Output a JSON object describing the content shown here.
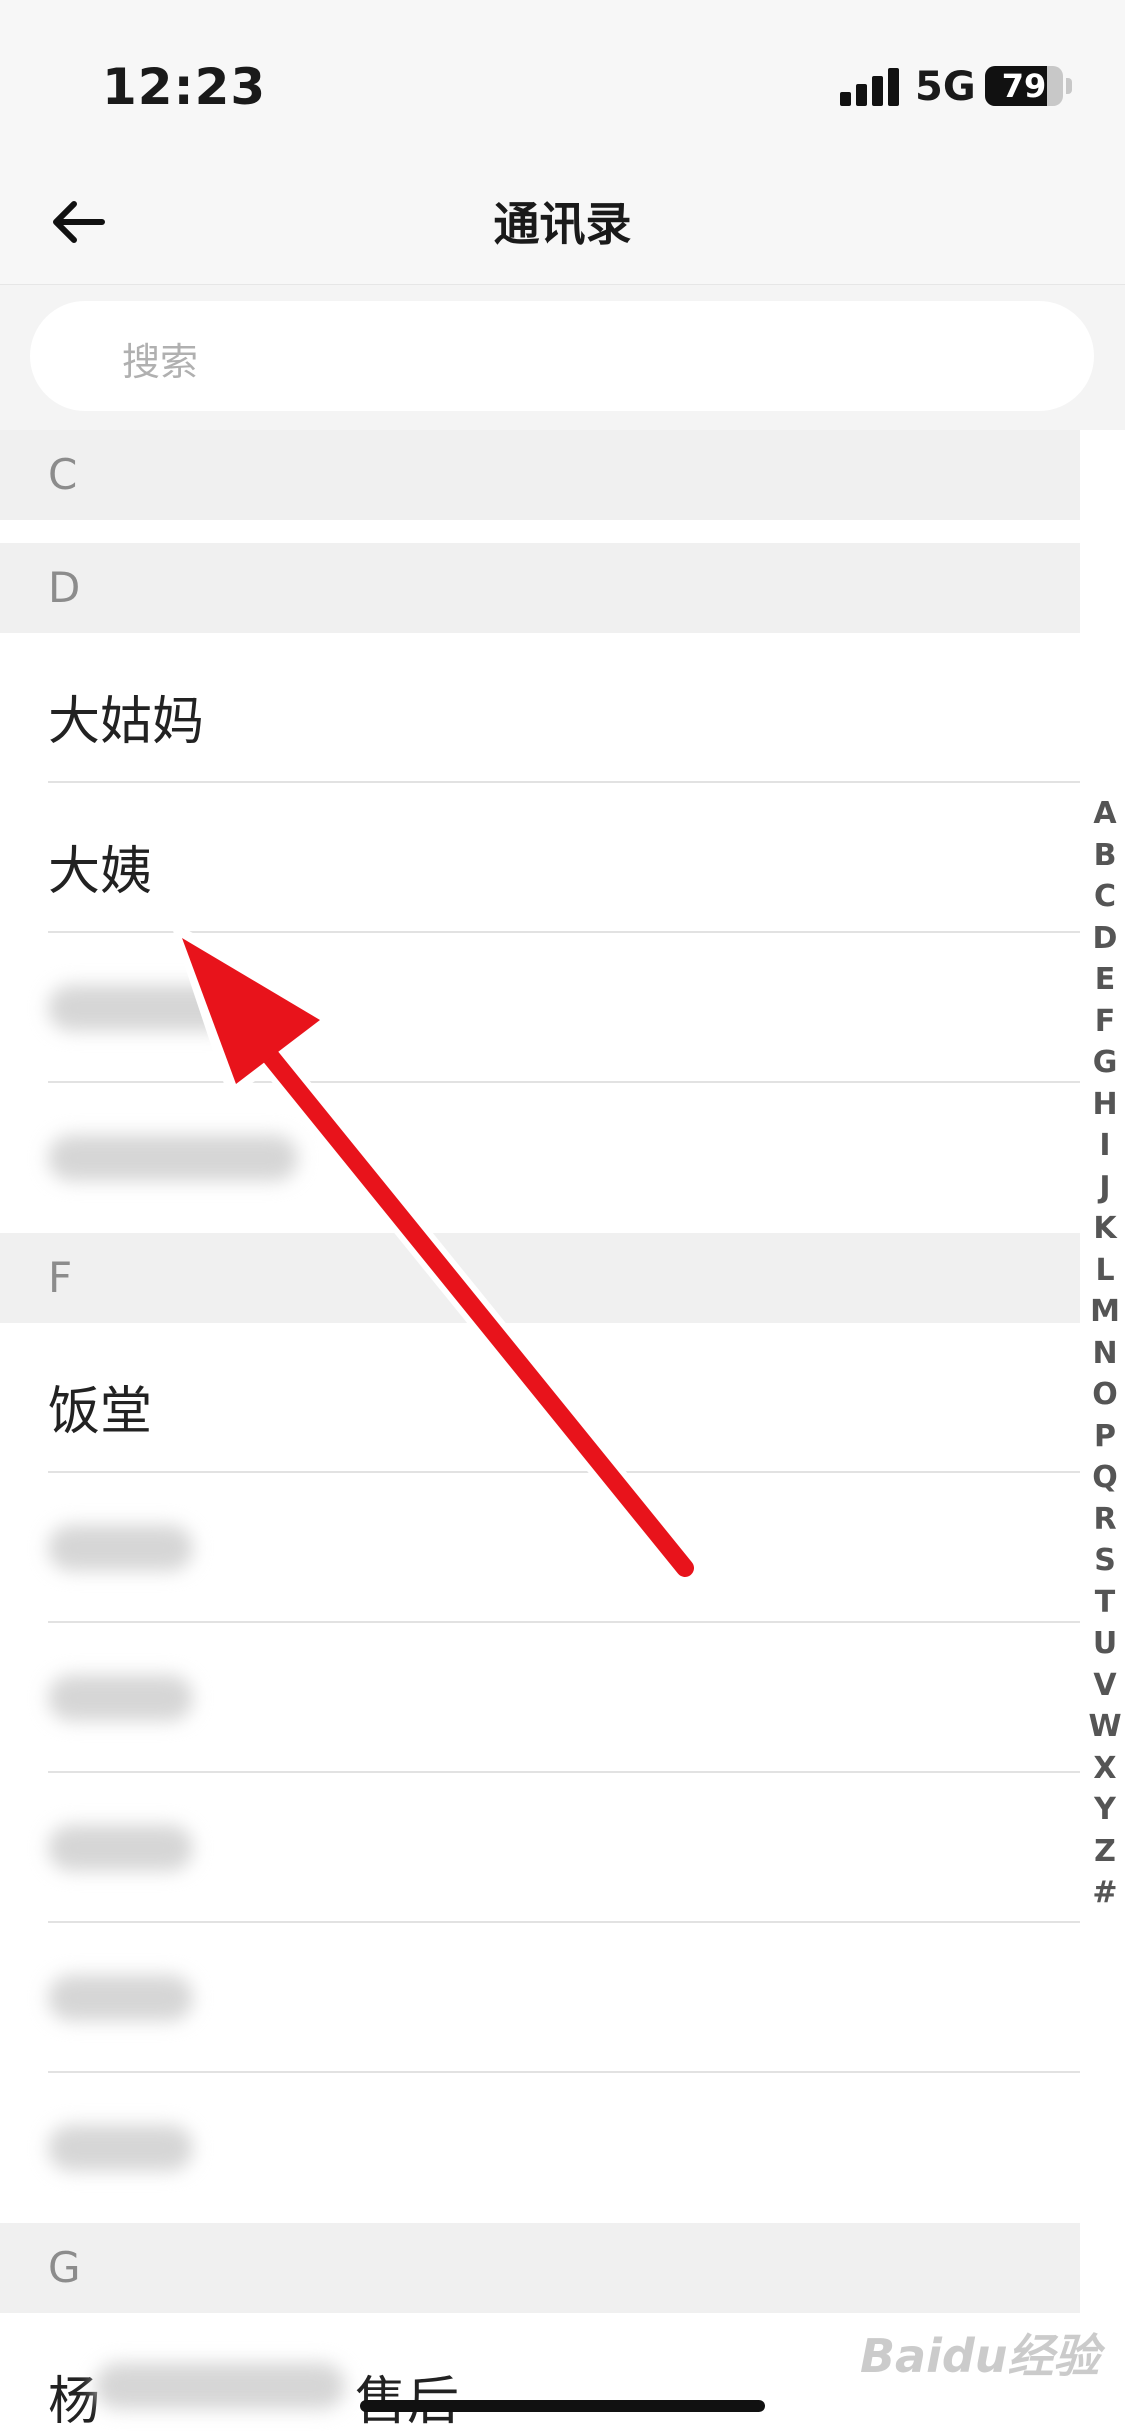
{
  "status_bar": {
    "time": "12:23",
    "network": "5G",
    "battery": "79",
    "battery_level": 0.79
  },
  "header": {
    "title": "通讯录",
    "back_icon": "arrow-left-icon"
  },
  "search": {
    "placeholder": "搜索"
  },
  "sections": [
    {
      "letter": "C",
      "contacts": []
    },
    {
      "letter": "D",
      "contacts": [
        "大姑妈",
        "大姨",
        "",
        ""
      ]
    },
    {
      "letter": "F",
      "contacts": [
        "饭堂",
        "",
        "",
        "",
        "",
        ""
      ]
    },
    {
      "letter": "G",
      "contacts": [
        "杨",
        "售后"
      ]
    }
  ],
  "index_letters": [
    "A",
    "B",
    "C",
    "D",
    "E",
    "F",
    "G",
    "H",
    "I",
    "J",
    "K",
    "L",
    "M",
    "N",
    "O",
    "P",
    "Q",
    "R",
    "S",
    "T",
    "U",
    "V",
    "W",
    "X",
    "Y",
    "Z",
    "#"
  ],
  "annotation": {
    "color": "#e8131b"
  },
  "watermark": "Baidu经验"
}
